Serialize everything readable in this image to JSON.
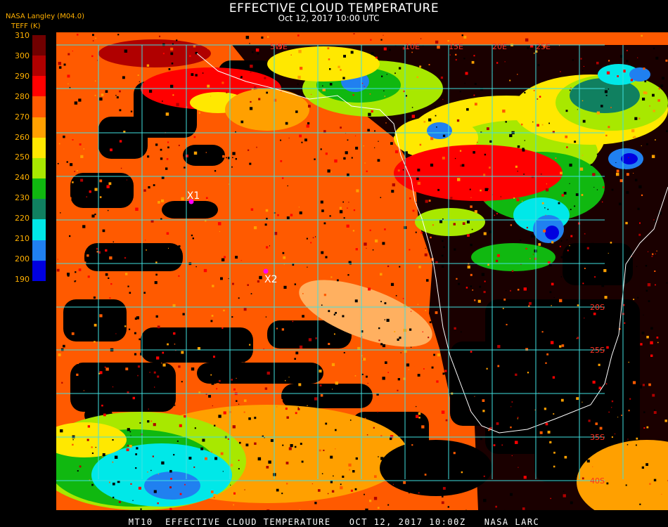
{
  "header": {
    "title": "EFFECTIVE CLOUD TEMPERATURE",
    "datetime": "Oct 12, 2017 10:00 UTC",
    "provider": "NASA Langley (M04.0)",
    "units": "TEFF (K)"
  },
  "legend": {
    "ticks": [
      "310",
      "300",
      "290",
      "280",
      "270",
      "260",
      "250",
      "240",
      "230",
      "220",
      "210",
      "200",
      "190"
    ],
    "colors": [
      "#700000",
      "#b00000",
      "#ff0000",
      "#ff5a00",
      "#ffa000",
      "#ffe800",
      "#a8e800",
      "#10b810",
      "#108060",
      "#00e8e8",
      "#2080f0",
      "#0000e0",
      "#8800cc"
    ]
  },
  "map": {
    "lon_labels": [
      "5W",
      "5E",
      "10E",
      "15E",
      "20E",
      "25E"
    ],
    "lat_labels": [
      "20S",
      "25S",
      "35S",
      "40S"
    ],
    "markers": [
      {
        "label": "X1",
        "lon": -12,
        "lat": -7
      },
      {
        "label": "X2",
        "lon": -3,
        "lat": -14
      }
    ],
    "gridline_color": "#40e0e0",
    "label_color": "#ff3020",
    "coast_color": "#ffffff",
    "marker_color": "#ff00ff"
  },
  "footer": "MT10  EFFECTIVE CLOUD TEMPERATURE   OCT 12, 2017 10:00Z   NASA LARC"
}
